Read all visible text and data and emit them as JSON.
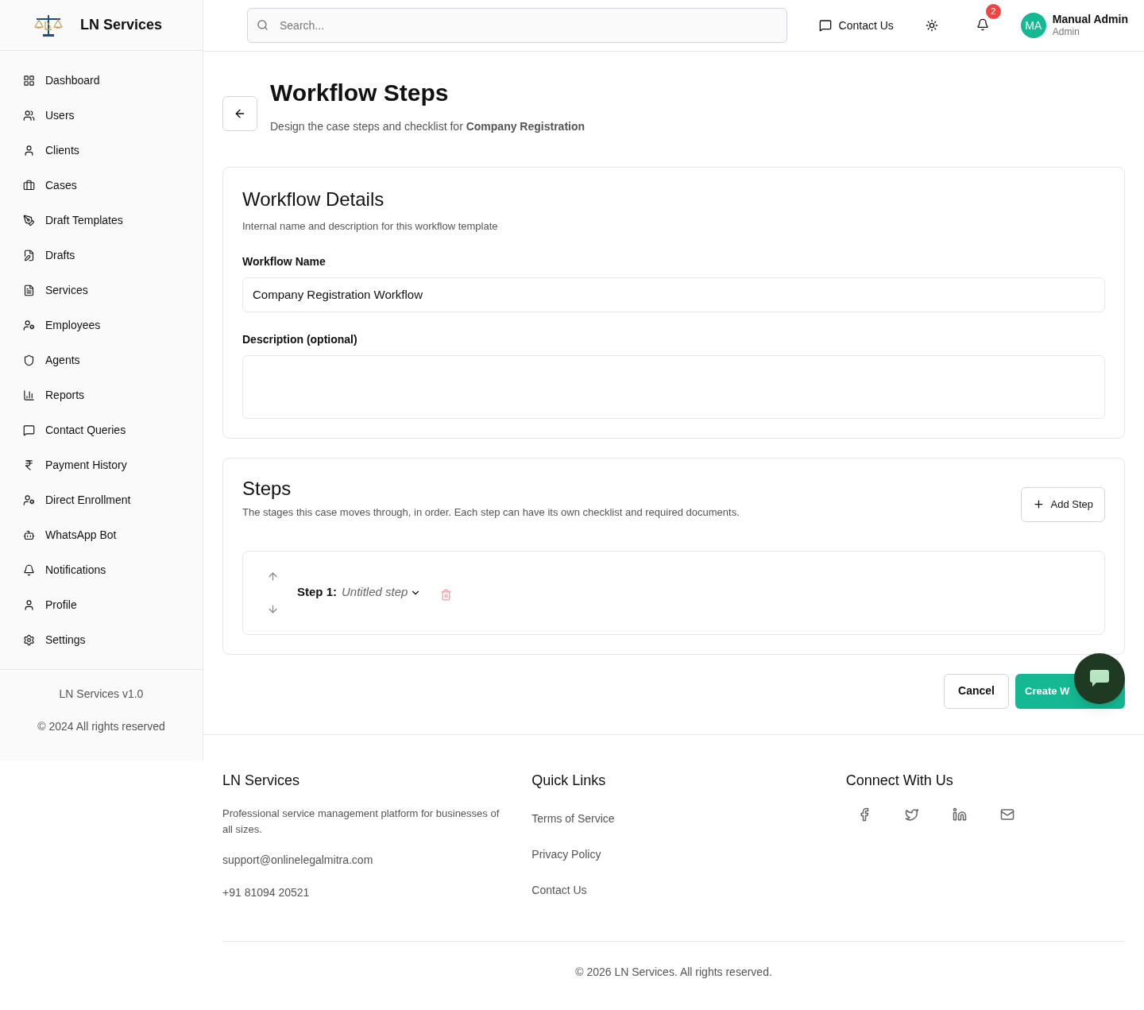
{
  "brand": {
    "name": "LN Services"
  },
  "sidebar": {
    "items": [
      {
        "label": "Dashboard"
      },
      {
        "label": "Users"
      },
      {
        "label": "Clients"
      },
      {
        "label": "Cases"
      },
      {
        "label": "Draft Templates"
      },
      {
        "label": "Drafts"
      },
      {
        "label": "Services"
      },
      {
        "label": "Employees"
      },
      {
        "label": "Agents"
      },
      {
        "label": "Reports"
      },
      {
        "label": "Contact Queries"
      },
      {
        "label": "Payment History"
      },
      {
        "label": "Direct Enrollment"
      },
      {
        "label": "WhatsApp Bot"
      },
      {
        "label": "Notifications"
      },
      {
        "label": "Profile"
      },
      {
        "label": "Settings"
      }
    ],
    "version": "LN Services v1.0",
    "copyright": "© 2024 All rights reserved"
  },
  "header": {
    "search": {
      "placeholder": "Search..."
    },
    "contact": "Contact Us",
    "notification_count": "2",
    "user": {
      "initials": "MA",
      "name": "Manual Admin",
      "role": "Admin"
    }
  },
  "page": {
    "title": "Workflow Steps",
    "subtitle": "Design the case steps and checklist for **Company Registration**"
  },
  "details": {
    "title": "Workflow Details",
    "description": "Internal name and description for this workflow template",
    "fields": [
      {
        "label": "Workflow Name",
        "value": "Company Registration Workflow",
        "kind": "input"
      },
      {
        "label": "Description (optional)",
        "kind": "textarea"
      }
    ]
  },
  "steps": {
    "title": "Steps",
    "description": "The stages this case moves through, in order. Each step can have its own checklist and required documents.",
    "add_button": "Add Step",
    "items": [
      {
        "label": "Step 1:",
        "name": "Untitled step",
        "expanded": false
      }
    ]
  },
  "actions": {
    "cancel": "Cancel",
    "submit": "Create W"
  },
  "footer": {
    "about": {
      "title": "LN Services",
      "text": "Professional service management platform for businesses of all sizes.",
      "email": "support@onlinelegalmitra.com",
      "phone": "+91 81094 20521"
    },
    "links": {
      "title": "Quick Links",
      "items": [
        "Terms of Service",
        "Privacy Policy",
        "Contact Us"
      ]
    },
    "social": {
      "title": "Connect With Us"
    },
    "copyright": "© 2026 LN Services. All rights reserved."
  }
}
